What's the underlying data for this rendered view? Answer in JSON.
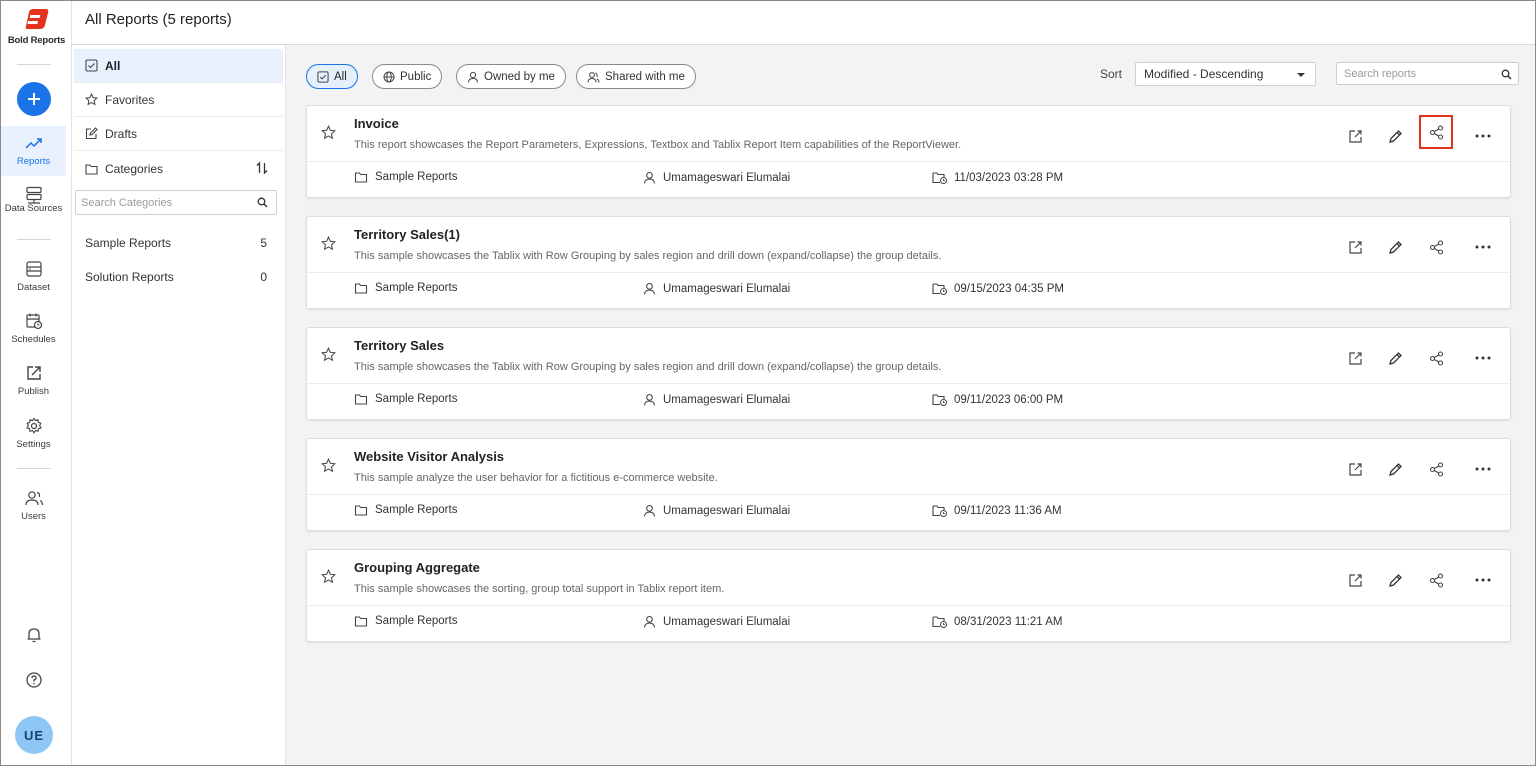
{
  "app": {
    "brand": "Bold Reports",
    "page_title": "All Reports (5 reports)",
    "colors": {
      "accent": "#1a73e8",
      "brand_red": "#e5321e",
      "highlight_border": "#e5321e"
    }
  },
  "rail": {
    "add_icon": "plus-icon",
    "items": [
      {
        "label": "Reports",
        "icon": "trend-icon",
        "active": true
      },
      {
        "label": "Data Sources",
        "icon": "server-icon",
        "active": false
      },
      {
        "label": "Dataset",
        "icon": "dataset-icon",
        "active": false
      },
      {
        "label": "Schedules",
        "icon": "calendar-clock-icon",
        "active": false
      },
      {
        "label": "Publish",
        "icon": "publish-icon",
        "active": false
      },
      {
        "label": "Settings",
        "icon": "gear-icon",
        "active": false
      },
      {
        "label": "Users",
        "icon": "users-icon",
        "active": false
      }
    ],
    "bottom": [
      "bell-icon",
      "help-icon"
    ],
    "avatar": "UE"
  },
  "categories_panel": {
    "items": [
      {
        "label": "All",
        "icon": "checkbox-icon",
        "active": true
      },
      {
        "label": "Favorites",
        "icon": "star-icon",
        "active": false
      },
      {
        "label": "Drafts",
        "icon": "edit-icon",
        "active": false
      },
      {
        "label": "Categories",
        "icon": "folder-icon",
        "active": false
      }
    ],
    "search_placeholder": "Search Categories",
    "categories": [
      {
        "name": "Sample Reports",
        "count": "5"
      },
      {
        "name": "Solution Reports",
        "count": "0"
      }
    ]
  },
  "filters": {
    "chips": [
      {
        "label": "All",
        "icon": "checkbox-icon",
        "active": true
      },
      {
        "label": "Public",
        "icon": "globe-icon",
        "active": false
      },
      {
        "label": "Owned by me",
        "icon": "user-icon",
        "active": false
      },
      {
        "label": "Shared with me",
        "icon": "shared-users-icon",
        "active": false
      }
    ],
    "sort_label": "Sort",
    "sort_value": "Modified - Descending",
    "search_placeholder": "Search reports"
  },
  "reports": [
    {
      "title": "Invoice",
      "description": "This report showcases the Report Parameters, Expressions, Textbox and Tablix Report Item capabilities of the ReportViewer.",
      "category": "Sample Reports",
      "owner": "Umamageswari Elumalai",
      "modified": "11/03/2023 03:28 PM",
      "share_highlighted": true
    },
    {
      "title": "Territory Sales(1)",
      "description": "This sample showcases the Tablix with Row Grouping by sales region and drill down (expand/collapse) the group details.",
      "category": "Sample Reports",
      "owner": "Umamageswari Elumalai",
      "modified": "09/15/2023 04:35 PM",
      "share_highlighted": false
    },
    {
      "title": "Territory Sales",
      "description": "This sample showcases the Tablix with Row Grouping by sales region and drill down (expand/collapse) the group details.",
      "category": "Sample Reports",
      "owner": "Umamageswari Elumalai",
      "modified": "09/11/2023 06:00 PM",
      "share_highlighted": false
    },
    {
      "title": "Website Visitor Analysis",
      "description": "This sample analyze the user behavior for a fictitious e-commerce website.",
      "category": "Sample Reports",
      "owner": "Umamageswari Elumalai",
      "modified": "09/11/2023 11:36 AM",
      "share_highlighted": false
    },
    {
      "title": "Grouping Aggregate",
      "description": "This sample showcases the sorting, group total support in Tablix report item.",
      "category": "Sample Reports",
      "owner": "Umamageswari Elumalai",
      "modified": "08/31/2023 11:21 AM",
      "share_highlighted": false
    }
  ]
}
